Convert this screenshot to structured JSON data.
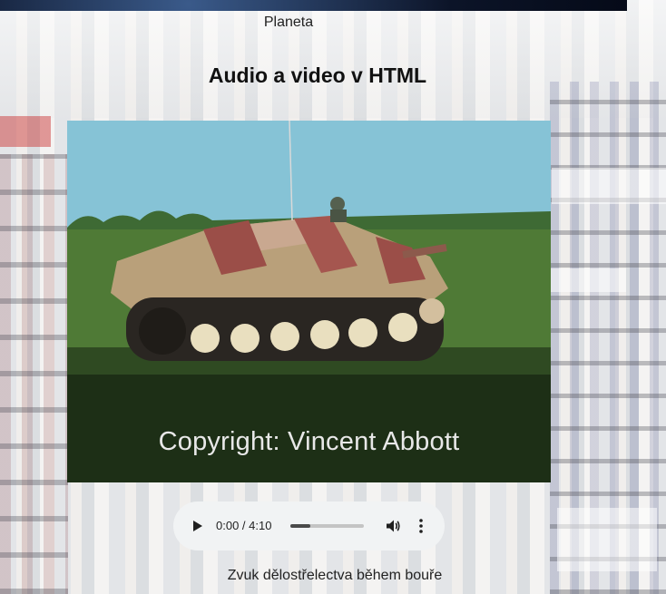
{
  "header": {
    "previous_image_caption": "Planeta"
  },
  "page": {
    "title": "Audio a video v HTML"
  },
  "video": {
    "overlay_text": "Copyright: Vincent Abbott"
  },
  "audio_player": {
    "current_time": "0:00",
    "duration": "4:10",
    "time_display": "0:00 / 4:10",
    "buffered_fraction": 0.27,
    "icons": [
      "play-icon",
      "volume-icon",
      "more-options-icon"
    ]
  },
  "audio_caption": "Zvuk dělostřelectva během bouře"
}
